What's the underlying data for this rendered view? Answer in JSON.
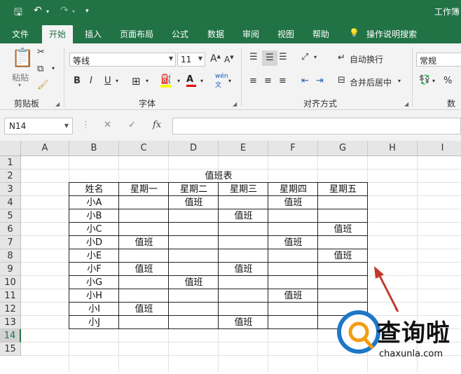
{
  "title_bar": {
    "doc_title": "工作簿"
  },
  "tabs": [
    "文件",
    "开始",
    "插入",
    "页面布局",
    "公式",
    "数据",
    "审阅",
    "视图",
    "帮助"
  ],
  "active_tab": "开始",
  "tell_me": "操作说明搜索",
  "ribbon": {
    "paste_label": "粘贴",
    "clipboard_group": "剪贴板",
    "font_name": "等线",
    "font_size": "11",
    "font_group": "字体",
    "bold": "B",
    "italic": "I",
    "underline": "U",
    "phonetic": "wén",
    "wrap_text": "自动换行",
    "merge_center": "合并后居中",
    "alignment_group": "对齐方式",
    "number_format": "常规",
    "number_group": "数字",
    "percent": "%",
    "font_grow": "A",
    "font_shrink": "A"
  },
  "formula_bar": {
    "name_box": "N14",
    "fx": "fx",
    "value": ""
  },
  "columns": [
    "A",
    "B",
    "C",
    "D",
    "E",
    "F",
    "G",
    "H",
    "I"
  ],
  "rows": [
    "1",
    "2",
    "3",
    "4",
    "5",
    "6",
    "7",
    "8",
    "9",
    "10",
    "11",
    "12",
    "13",
    "14",
    "15"
  ],
  "selected_row": "14",
  "sheet": {
    "title": "值班表",
    "headers": [
      "姓名",
      "星期一",
      "星期二",
      "星期三",
      "星期四",
      "星期五"
    ],
    "rows": [
      [
        "小A",
        "",
        "值班",
        "",
        "值班",
        ""
      ],
      [
        "小B",
        "",
        "",
        "值班",
        "",
        ""
      ],
      [
        "小C",
        "",
        "",
        "",
        "",
        "值班"
      ],
      [
        "小D",
        "值班",
        "",
        "",
        "值班",
        ""
      ],
      [
        "小E",
        "",
        "",
        "",
        "",
        "值班"
      ],
      [
        "小F",
        "值班",
        "",
        "值班",
        "",
        ""
      ],
      [
        "小G",
        "",
        "值班",
        "",
        "",
        ""
      ],
      [
        "小H",
        "",
        "",
        "",
        "值班",
        ""
      ],
      [
        "小I",
        "值班",
        "",
        "",
        "",
        ""
      ],
      [
        "小J",
        "",
        "",
        "值班",
        "",
        ""
      ]
    ]
  },
  "watermark": {
    "brand": "查询啦",
    "url": "chaxunla.com"
  },
  "colors": {
    "excel_green": "#217346",
    "arrow_red": "#c0392b",
    "watermark_blue": "#1e78c8"
  }
}
